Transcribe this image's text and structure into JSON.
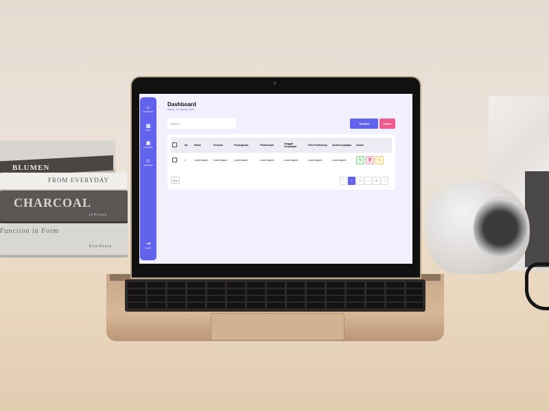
{
  "books": {
    "b1_title": "BLUMEN",
    "b2_title": "FROM EVERYDAY",
    "b3_title": "CHARCOAL",
    "b3_publisher": "teNeues",
    "b4_title": "Function in Form",
    "b4_publisher": "EverPress"
  },
  "sidebar": {
    "items": [
      {
        "label": "Dashboard",
        "icon": "home-icon"
      },
      {
        "label": "Kader",
        "icon": "building-icon"
      },
      {
        "label": "Kunjungan",
        "icon": "clipboard-icon"
      },
      {
        "label": "Kunjungan",
        "icon": "user-icon"
      }
    ],
    "logout_label": "Keluar",
    "logout_icon": "logout-icon",
    "color": "#6163ec"
  },
  "header": {
    "title": "Dashboard",
    "date": "Kamis, 26 Oktober 2023"
  },
  "search": {
    "placeholder": "Search..."
  },
  "actions": {
    "add_label": "Tambah",
    "delete_label": "Hapus"
  },
  "table": {
    "columns": [
      "No",
      "Nama",
      "Keluhan",
      "Penanganan",
      "Fisioterapis",
      "Tanggal Kunjungan",
      "Foto Pendukung",
      "Surat Kunjungan",
      "Action"
    ],
    "rows": [
      {
        "no": "1",
        "nama": "Lorem Ipsum",
        "keluhan": "Lorem Ipsum",
        "penanganan": "Lorem Ipsum",
        "fisioterapis": "Lorem Ipsum",
        "tanggal": "Lorem Ipsum",
        "foto": "Lorem Ipsum",
        "surat": "Lorem Ipsum"
      }
    ],
    "action_icons": [
      "pencil-icon",
      "trash-icon",
      "star-icon"
    ]
  },
  "pagination": {
    "per_page": "10",
    "prev": "‹",
    "pages": [
      "1",
      "2",
      "...",
      "8"
    ],
    "next": "›",
    "active_page": "1"
  }
}
